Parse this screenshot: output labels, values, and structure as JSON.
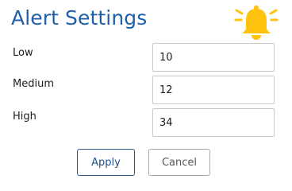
{
  "header": {
    "title": "Alert Settings",
    "icon": "bell-icon",
    "icon_color": "#FFC20E"
  },
  "fields": [
    {
      "label": "Low",
      "value": "10"
    },
    {
      "label": "Medium",
      "value": "12"
    },
    {
      "label": "High",
      "value": "34"
    }
  ],
  "actions": {
    "apply_label": "Apply",
    "cancel_label": "Cancel"
  },
  "colors": {
    "title": "#1F5FA8",
    "apply_border": "#2A5D8F",
    "cancel_border": "#A8A8A8"
  }
}
